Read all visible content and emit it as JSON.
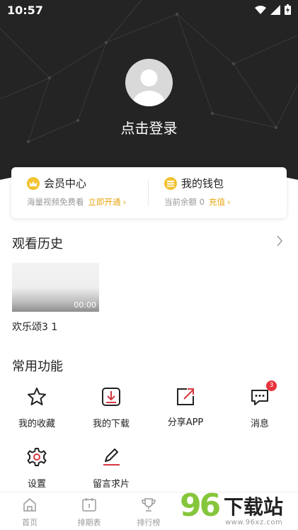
{
  "status_bar": {
    "time": "10:57"
  },
  "profile": {
    "login_text": "点击登录"
  },
  "membership": {
    "title": "会员中心",
    "subtitle": "海量视频免费看",
    "action": "立即开通"
  },
  "wallet": {
    "title": "我的钱包",
    "subtitle": "当前余额 0",
    "action": "充值"
  },
  "history": {
    "title": "观看历史",
    "items": [
      {
        "title": "欢乐颂3 1",
        "duration": "00:00"
      }
    ]
  },
  "functions": {
    "title": "常用功能",
    "items": [
      {
        "label": "我的收藏",
        "icon": "star-icon"
      },
      {
        "label": "我的下载",
        "icon": "download-icon"
      },
      {
        "label": "分享APP",
        "icon": "share-icon"
      },
      {
        "label": "消息",
        "icon": "message-icon",
        "badge": "3"
      },
      {
        "label": "设置",
        "icon": "gear-icon"
      },
      {
        "label": "留言求片",
        "icon": "edit-icon"
      }
    ]
  },
  "bottom_nav": [
    {
      "label": "首页",
      "icon": "home-icon"
    },
    {
      "label": "排期表",
      "icon": "calendar-icon"
    },
    {
      "label": "排行榜",
      "icon": "trophy-icon"
    }
  ],
  "watermark": {
    "number": "96",
    "text": "下载站",
    "site": "www.96xz.com"
  },
  "colors": {
    "header_bg": "#242424",
    "accent": "#e7a510",
    "brand_red": "#d7373f",
    "badge": "#e8323c",
    "watermark_green": "#86c63c"
  }
}
